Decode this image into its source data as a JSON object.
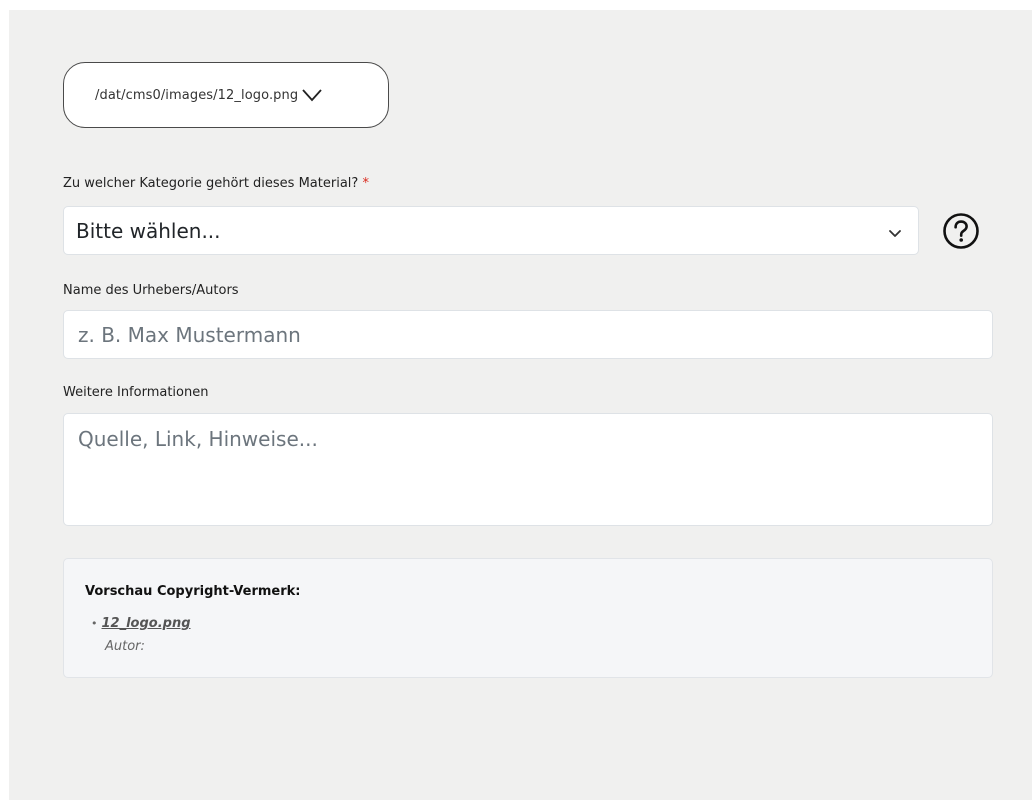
{
  "file_selector": {
    "path": "/dat/cms0/images/12_logo.png",
    "icon": "chevron-down-icon"
  },
  "category": {
    "label": "Zu welcher Kategorie gehört dieses Material?",
    "required_mark": "*",
    "selected": "Bitte wählen...",
    "help_icon": "question-circle-icon"
  },
  "author": {
    "label": "Name des Urhebers/Autors",
    "value": "",
    "placeholder": "z. B. Max Mustermann"
  },
  "info": {
    "label": "Weitere Informationen",
    "value": "",
    "placeholder": "Quelle, Link, Hinweise..."
  },
  "preview": {
    "title": "Vorschau Copyright-Vermerk:",
    "bullet": "•",
    "file_name": "12_logo.png",
    "author_label": "Autor:"
  },
  "colors": {
    "panel_bg": "#f0f0ef",
    "required": "#d9281c",
    "preview_bg": "#f5f6f8"
  }
}
